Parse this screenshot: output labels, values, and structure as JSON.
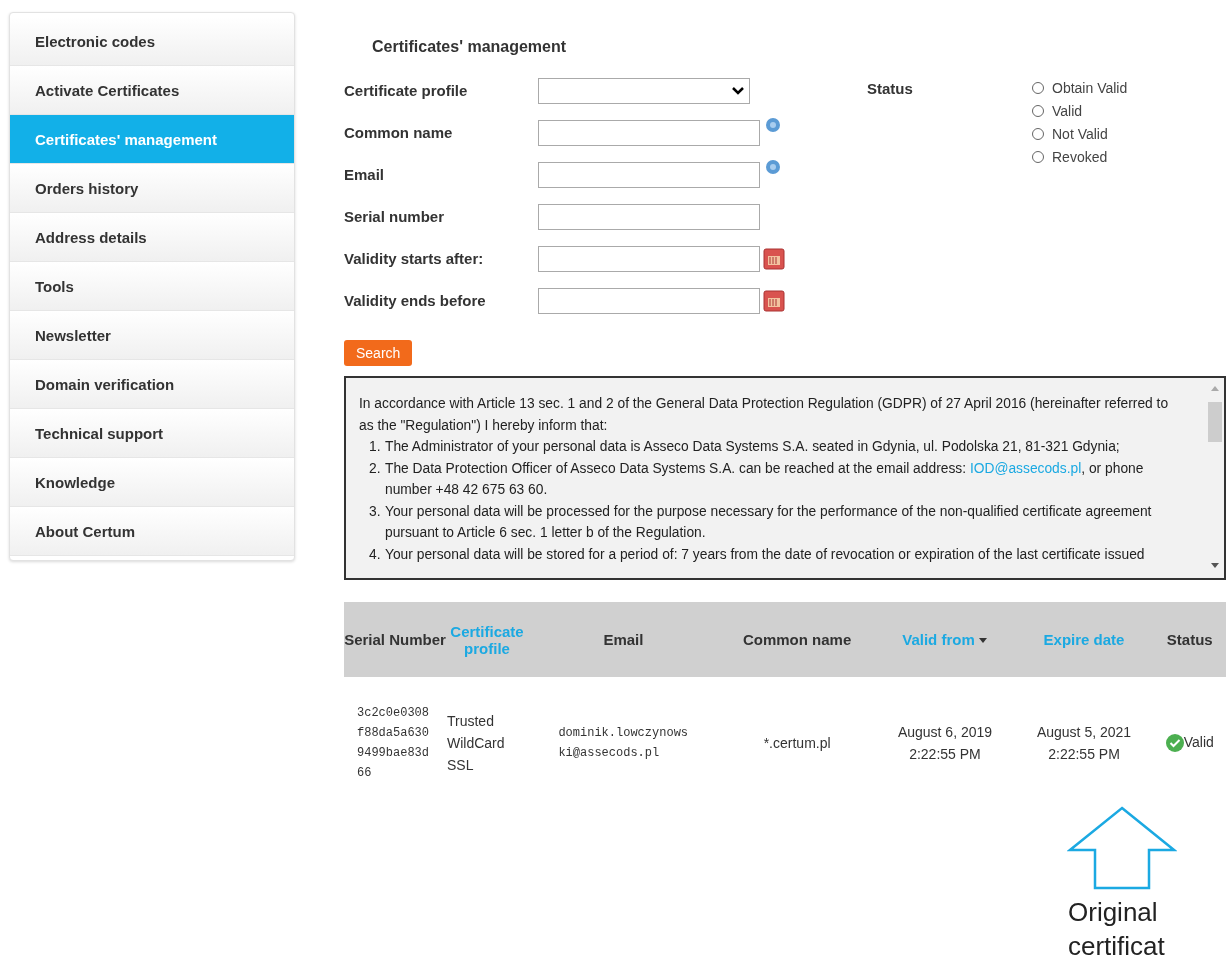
{
  "sidebar": {
    "items": [
      {
        "label": "Electronic codes",
        "selected": false
      },
      {
        "label": "Activate Certificates",
        "selected": false
      },
      {
        "label": "Certificates' management",
        "selected": true
      },
      {
        "label": "Orders history",
        "selected": false
      },
      {
        "label": "Address details",
        "selected": false
      },
      {
        "label": "Tools",
        "selected": false
      },
      {
        "label": "Newsletter",
        "selected": false
      },
      {
        "label": "Domain verification",
        "selected": false
      },
      {
        "label": "Technical support",
        "selected": false
      },
      {
        "label": "Knowledge",
        "selected": false
      },
      {
        "label": "About Certum",
        "selected": false
      }
    ]
  },
  "page_title": "Certificates' management",
  "form": {
    "fields": [
      {
        "label": "Certificate profile",
        "kind": "select"
      },
      {
        "label": "Common name",
        "kind": "help"
      },
      {
        "label": "Email",
        "kind": "help"
      },
      {
        "label": "Serial number",
        "kind": "text"
      },
      {
        "label": "Validity starts after:",
        "kind": "date"
      },
      {
        "label": "Validity ends before",
        "kind": "date"
      }
    ],
    "status_label": "Status",
    "status_options": [
      {
        "label": "Obtain Valid",
        "selected": false
      },
      {
        "label": "Valid",
        "selected": false
      },
      {
        "label": "Not Valid",
        "selected": false
      },
      {
        "label": "Revoked",
        "selected": false
      }
    ],
    "search_button": "Search"
  },
  "notice": {
    "intro": "In accordance with Article 13 sec. 1 and 2 of the General Data Protection Regulation (GDPR) of 27 April 2016 (hereinafter referred to as the \"Regulation\") I hereby inform that:",
    "items": [
      {
        "number": "1.",
        "text": "The Administrator of your personal data is Asseco Data Systems S.A. seated in Gdynia, ul. Podolska 21, 81-321 Gdynia;"
      },
      {
        "number": "2.",
        "text": "The Data Protection Officer of Asseco Data Systems S.A. can be reached at the email address: ",
        "link": "IOD@assecods.pl",
        "after": ", or phone number +48 42 675 63 60."
      },
      {
        "number": "3.",
        "text": "Your personal data will be processed for the purpose necessary for the performance of the non-qualified certificate agreement pursuant to Article 6 sec. 1 letter b of the Regulation."
      },
      {
        "number": "4.",
        "text": "Your personal data will be stored for a period of: 7 years from the date of revocation or expiration of the last certificate issued"
      }
    ]
  },
  "table": {
    "columns": [
      {
        "label": "Serial Number",
        "sortable": false
      },
      {
        "label": "Certificate profile",
        "sortable": true
      },
      {
        "label": "Email",
        "sortable": false
      },
      {
        "label": "Common name",
        "sortable": false
      },
      {
        "label": "Valid from",
        "sortable": true,
        "sorted": true
      },
      {
        "label": "Expire date",
        "sortable": true,
        "sorted": false
      },
      {
        "label": "Status",
        "sortable": false
      }
    ],
    "rows": [
      {
        "serial": "3c2c0e0308f88da5a6309499bae83d66",
        "profile": "Trusted WildCard SSL",
        "email": "dominik.lowczynowski@assecods.pl",
        "common_name": "*.certum.pl",
        "valid_from": [
          "August 6, 2019",
          "2:22:55 PM"
        ],
        "expire_date": [
          "August 5, 2021",
          "2:22:55 PM"
        ],
        "status": "Valid"
      }
    ]
  },
  "callout": {
    "lines": [
      "Original",
      "certificat"
    ]
  }
}
